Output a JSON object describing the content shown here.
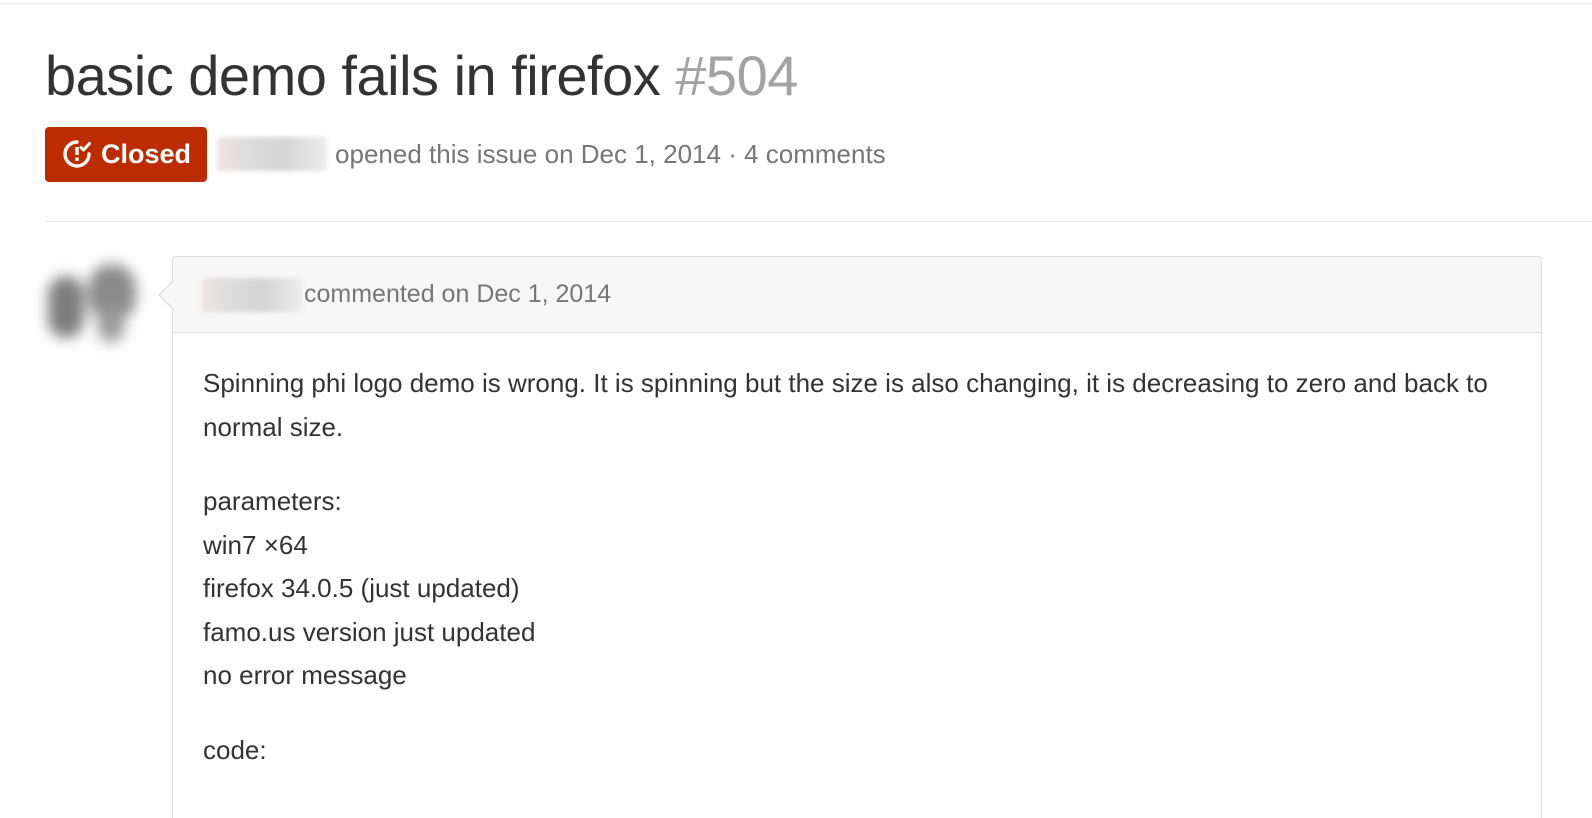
{
  "issue": {
    "title": "basic demo fails in firefox",
    "number": "#504",
    "state": "Closed",
    "state_color": "#bd2c00",
    "state_icon": "issue-closed-icon",
    "meta_text": "opened this issue on Dec 1, 2014 · 4 comments"
  },
  "comment": {
    "meta_text": "commented on Dec 1, 2014",
    "body": {
      "paragraph1": "Spinning phi logo demo is wrong. It is spinning but the size is also changing, it is decreasing to zero and back to normal size.",
      "parameters_lines": [
        "parameters:",
        "win7 ×64",
        "firefox 34.0.5 (just updated)",
        "famo.us version just updated",
        "no error message"
      ],
      "code_label": "code:"
    }
  }
}
